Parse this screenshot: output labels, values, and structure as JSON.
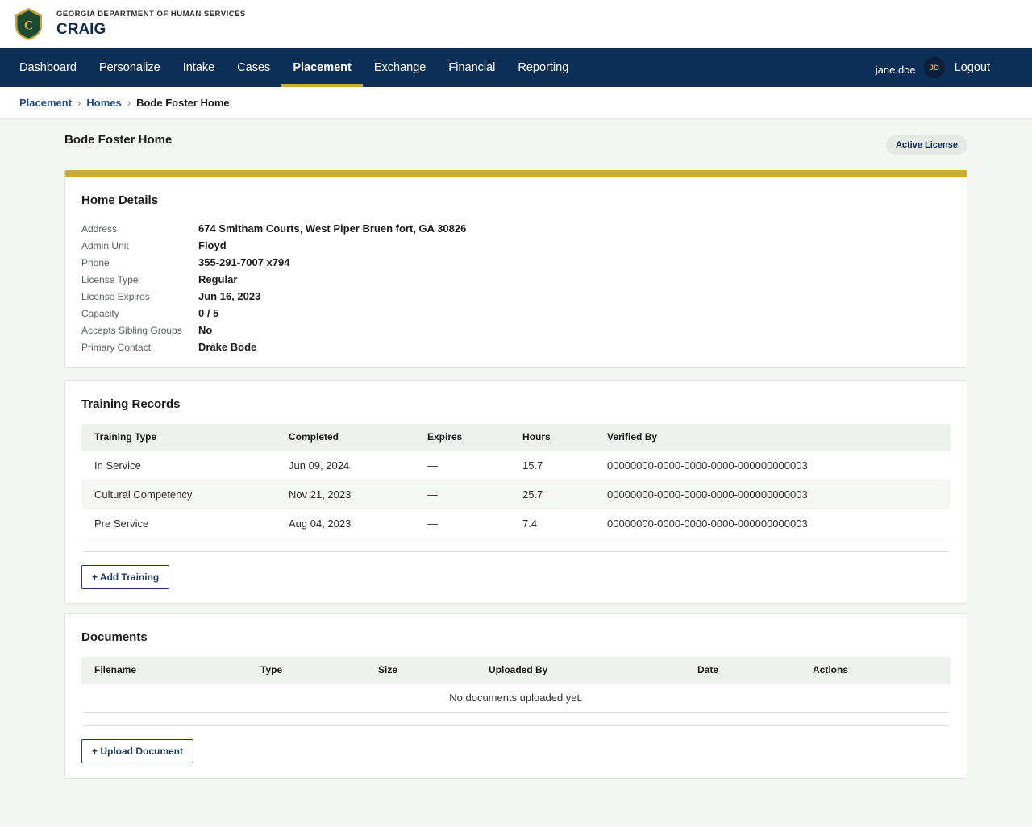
{
  "header": {
    "org": "GEORGIA DEPARTMENT OF HUMAN SERVICES",
    "app": "CRAIG",
    "logo_letter": "C"
  },
  "nav": {
    "items": [
      {
        "label": "Dashboard",
        "active": false
      },
      {
        "label": "Personalize",
        "active": false
      },
      {
        "label": "Intake",
        "active": false
      },
      {
        "label": "Cases",
        "active": false
      },
      {
        "label": "Placement",
        "active": true
      },
      {
        "label": "Exchange",
        "active": false
      },
      {
        "label": "Financial",
        "active": false
      },
      {
        "label": "Reporting",
        "active": false
      }
    ],
    "username": "jane.doe",
    "avatar_initials": "JD",
    "logout_label": "Logout"
  },
  "breadcrumb": {
    "items": [
      "Placement",
      "Homes"
    ],
    "current": "Bode Foster Home",
    "separator": "›"
  },
  "page": {
    "title": "Bode Foster Home",
    "status_badge": "Active License"
  },
  "home_details": {
    "title": "Home Details",
    "rows": [
      {
        "label": "Address",
        "value": "674 Smitham Courts, West Piper Bruen fort, GA 30826"
      },
      {
        "label": "Admin Unit",
        "value": "Floyd"
      },
      {
        "label": "Phone",
        "value": "355-291-7007 x794"
      },
      {
        "label": "License Type",
        "value": "Regular"
      },
      {
        "label": "License Expires",
        "value": "Jun 16, 2023"
      },
      {
        "label": "Capacity",
        "value": "0 / 5"
      },
      {
        "label": "Accepts Sibling Groups",
        "value": "No"
      },
      {
        "label": "Primary Contact",
        "value": "Drake Bode"
      }
    ]
  },
  "training": {
    "title": "Training Records",
    "columns": [
      "Training Type",
      "Completed",
      "Expires",
      "Hours",
      "Verified By"
    ],
    "rows": [
      [
        "In Service",
        "Jun 09, 2024",
        "—",
        "15.7",
        "00000000-0000-0000-0000-000000000003"
      ],
      [
        "Cultural Competency",
        "Nov 21, 2023",
        "—",
        "25.7",
        "00000000-0000-0000-0000-000000000003"
      ],
      [
        "Pre Service",
        "Aug 04, 2023",
        "—",
        "7.4",
        "00000000-0000-0000-0000-000000000003"
      ]
    ],
    "add_label": "+ Add Training"
  },
  "documents": {
    "title": "Documents",
    "columns": [
      "Filename",
      "Type",
      "Size",
      "Uploaded By",
      "Date",
      "Actions"
    ],
    "empty_message": "No documents uploaded yet.",
    "upload_label": "+ Upload Document"
  },
  "colors": {
    "navy": "#0d2f57",
    "gold": "#d2a838",
    "logo_green": "#1d4a32"
  }
}
